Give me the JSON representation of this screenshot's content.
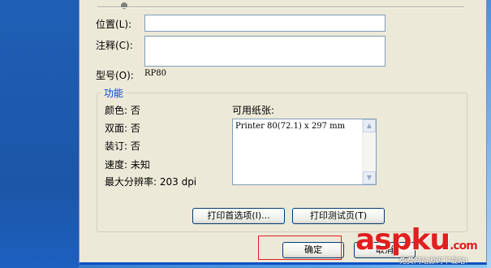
{
  "location": {
    "label": "位置(L):",
    "value": ""
  },
  "comment": {
    "label": "注释(C):",
    "value": ""
  },
  "model": {
    "label": "型号(O):",
    "value": "RP80"
  },
  "features": {
    "title": "功能",
    "color": "颜色: 否",
    "duplex": "双面: 否",
    "staple": "装订: 否",
    "speed": "速度: 未知",
    "resolution": "最大分辨率: 203 dpi",
    "paper_label": "可用纸张:",
    "paper_items": [
      "Printer 80(72.1) x 297 mm"
    ]
  },
  "buttons": {
    "preferences": "打印首选项(I)...",
    "test_page": "打印测试页(T)",
    "ok": "确定",
    "cancel": "取消"
  },
  "watermark": {
    "logo": "aspku",
    "logo_tld": ".com",
    "subtitle": "免费网站源码下载站!"
  },
  "colors": {
    "accent": "#0046d5",
    "highlight": "#e02020"
  }
}
